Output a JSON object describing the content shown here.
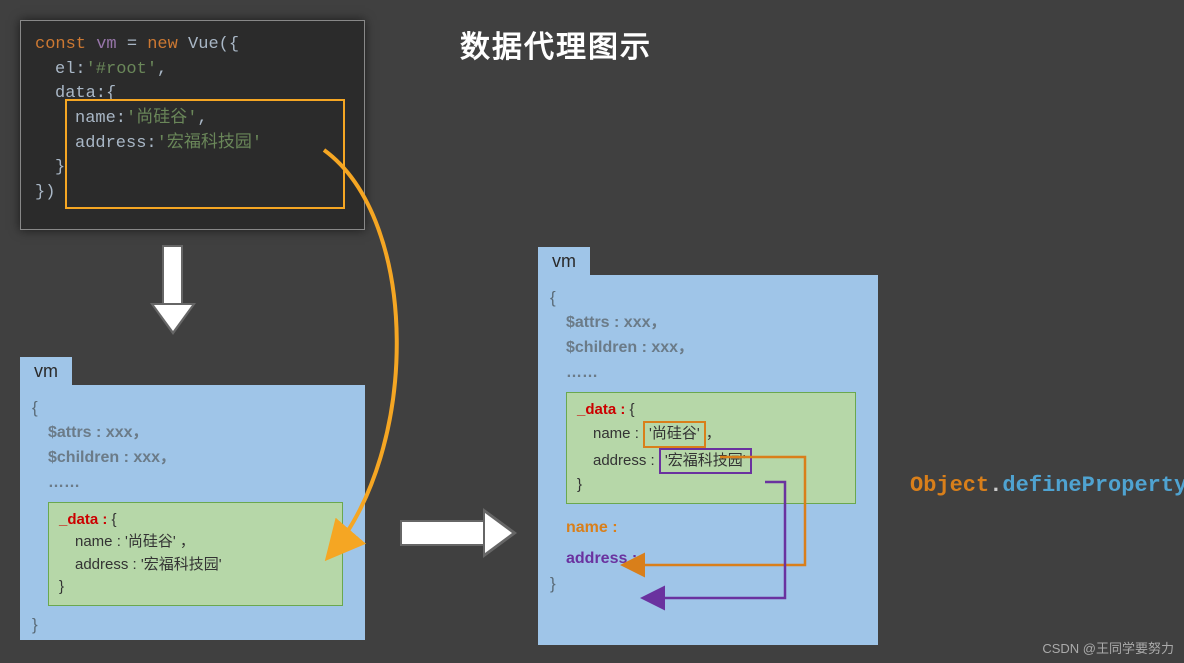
{
  "title": "数据代理图示",
  "code": {
    "line1_kw": "const",
    "line1_var": "vm",
    "line1_eq": " = ",
    "line1_new": "new",
    "line1_cls": " Vue",
    "line1_end": "({",
    "line2_prop": "el:",
    "line2_val": "'#root'",
    "line2_comma": ",",
    "line3_prop": "data:",
    "line3_brace": "{",
    "line4_prop": "name:",
    "line4_val": "'尚硅谷'",
    "line4_comma": ",",
    "line5_prop": "address:",
    "line5_val": "'宏福科技园'",
    "line6": "}",
    "line7": "})"
  },
  "vm1": {
    "tab": "vm",
    "open": "{",
    "attrs": "$attrs : xxx，",
    "children": "$children : xxx，",
    "dots": "……",
    "data_key": "_data :",
    "data_open": " {",
    "name_line": "name : '尚硅谷' ，",
    "address_line": "address : '宏福科技园'",
    "data_close": "}",
    "close": "}"
  },
  "vm2": {
    "tab": "vm",
    "open": "{",
    "attrs": "$attrs : xxx，",
    "children": "$children : xxx，",
    "dots": "……",
    "data_key": "_data :",
    "data_open": " {",
    "name_label": "name : ",
    "name_val": "'尚硅谷'",
    "name_comma": "，",
    "address_label": "address : ",
    "address_val": "'宏福科技园'",
    "data_close": "}",
    "proxy_name": "name :",
    "proxy_address": "address :",
    "close": "}"
  },
  "defprop": {
    "obj": "Object",
    "dot": ".",
    "method": "defineProperty"
  },
  "watermark": "CSDN @王同学要努力"
}
